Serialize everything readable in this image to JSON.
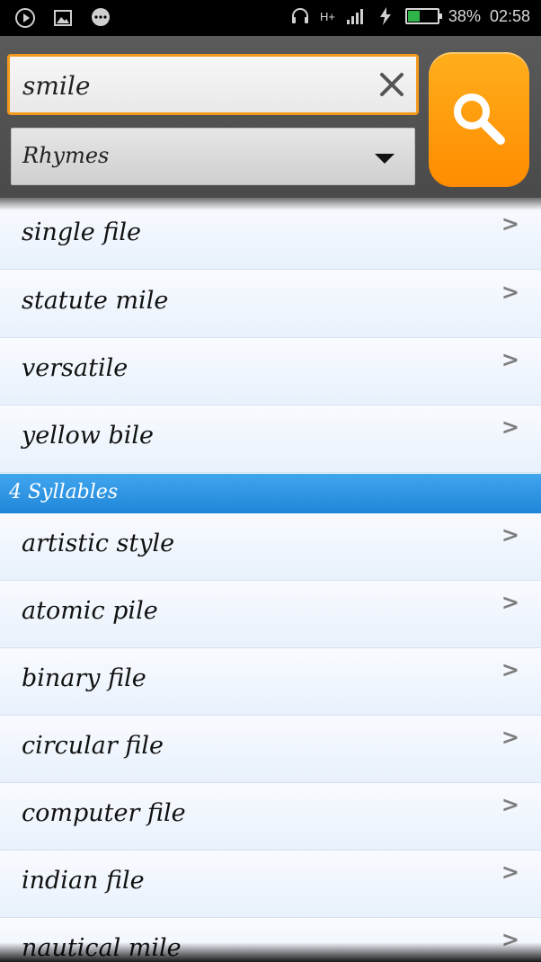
{
  "status_bar": {
    "left_icons": [
      "play-icon",
      "image-icon",
      "chat-icon"
    ],
    "network": "H+",
    "battery_percent": "38%",
    "battery_level": 0.38,
    "time": "02:58"
  },
  "search": {
    "value": "smile",
    "clear_icon": "close-icon"
  },
  "mode_select": {
    "value": "Rhymes"
  },
  "search_button": {
    "icon": "magnifier-icon",
    "color": "#ff9500"
  },
  "list": {
    "chevron": ">",
    "group_a": [
      "single file",
      "statute mile",
      "versatile",
      "yellow bile"
    ],
    "section_title": "4 Syllables",
    "group_b": [
      "artistic style",
      "atomic pile",
      "binary file",
      "circular file",
      "computer file",
      "indian file",
      "nautical mile"
    ]
  }
}
